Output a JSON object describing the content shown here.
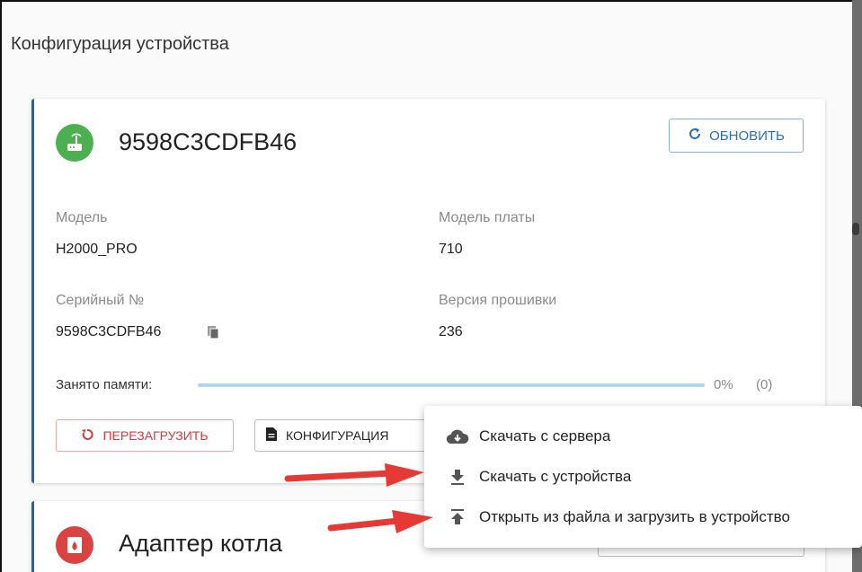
{
  "page": {
    "title": "Конфигурация устройства"
  },
  "device": {
    "name": "9598C3CDFB46",
    "refresh_label": "ОБНОВИТЬ",
    "model_label": "Модель",
    "model_value": "H2000_PRO",
    "board_label": "Модель платы",
    "board_value": "710",
    "serial_label": "Серийный №",
    "serial_value": "9598C3CDFB46",
    "firmware_label": "Версия прошивки",
    "firmware_value": "236",
    "memory_label": "Занято памяти:",
    "memory_percent": "0%",
    "memory_count": "(0)",
    "memory_fraction": 0,
    "reboot_label": "ПЕРЕЗАГРУЗИТЬ",
    "config_label": "КОНФИГУРАЦИЯ"
  },
  "adapter": {
    "name": "Адаптер котла"
  },
  "menu": {
    "items": [
      {
        "label": "Скачать с сервера",
        "icon": "cloud-download-icon"
      },
      {
        "label": "Скачать с устройства",
        "icon": "download-icon"
      },
      {
        "label": "Открыть из файла и загрузить в устройство",
        "icon": "upload-icon"
      }
    ]
  },
  "colors": {
    "accent": "#2a6cb7",
    "danger": "#d9363e",
    "success": "#4caf50",
    "annotation_arrow": "#e53935"
  }
}
